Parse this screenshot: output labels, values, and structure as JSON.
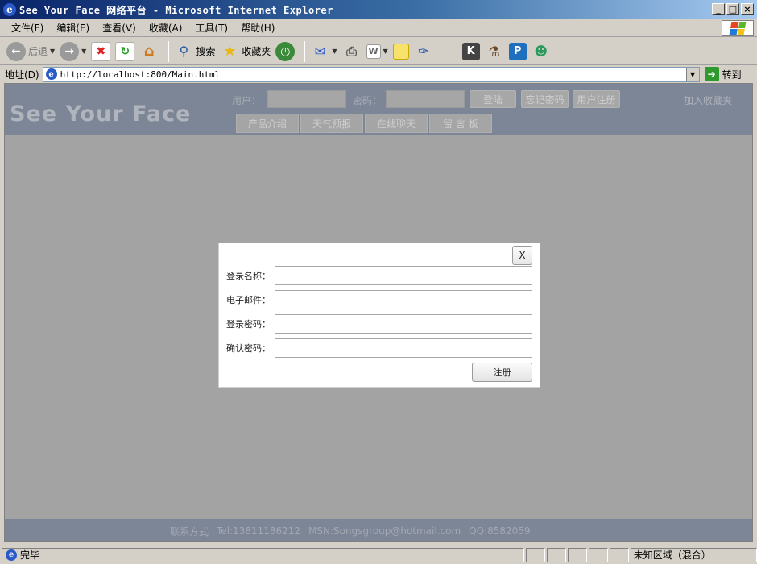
{
  "window": {
    "title": "See Your Face 网络平台 - Microsoft Internet Explorer",
    "minimize": "_",
    "maximize": "□",
    "close": "×"
  },
  "menu": [
    "文件(F)",
    "编辑(E)",
    "查看(V)",
    "收藏(A)",
    "工具(T)",
    "帮助(H)"
  ],
  "toolbar": {
    "back": "后退",
    "search": "搜索",
    "favorites": "收藏夹"
  },
  "address": {
    "label": "地址(D)",
    "url": "http://localhost:800/Main.html",
    "go": "转到"
  },
  "site": {
    "logo": "See Your Face",
    "user_label": "用户：",
    "password_label": "密码：",
    "login": "登陆",
    "forgot": "忘记密码",
    "register": "用户注册",
    "add_favorite": "加入收藏夹",
    "nav": [
      "产品介绍",
      "天气预报",
      "在线聊天",
      "留 言 板"
    ]
  },
  "modal": {
    "close": "X",
    "fields": [
      "登录名称：",
      "电子邮件：",
      "登录密码：",
      "确认密码："
    ],
    "submit": "注册"
  },
  "footer": {
    "contact": "联系方式",
    "tel": "Tel:13811186212",
    "msn": "MSN:Songsgroup@hotmail.com",
    "qq": "QQ:8582059"
  },
  "status": {
    "text": "完毕",
    "zone": "未知区域（混合）"
  }
}
